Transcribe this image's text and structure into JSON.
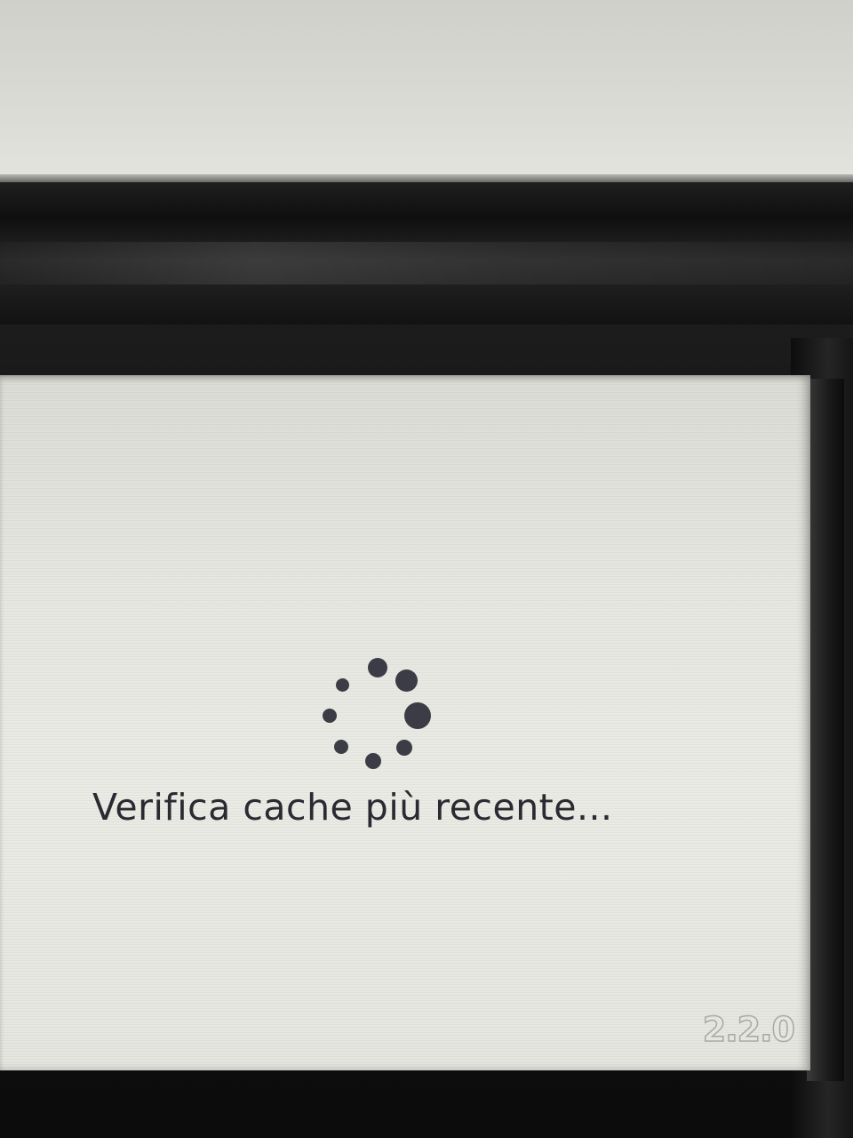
{
  "screen": {
    "status_text": "Verifica cache più recente...",
    "version_label": "2.2.0"
  },
  "spinner": {
    "icon": "loading-spinner-icon",
    "dot_count": 8,
    "color": "#3c3c46"
  }
}
